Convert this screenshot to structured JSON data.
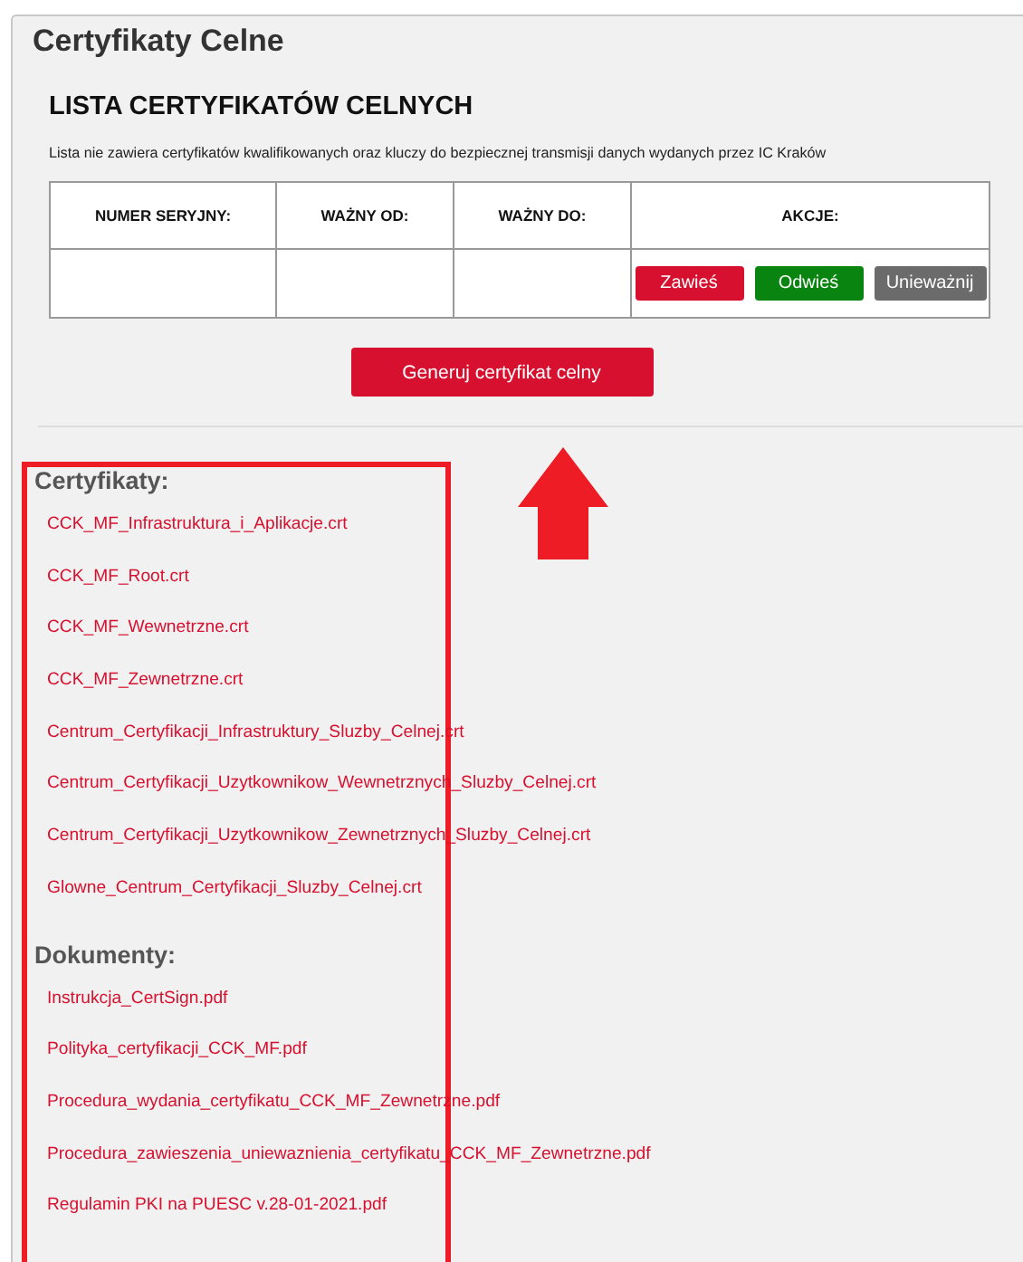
{
  "page": {
    "title": "Certyfikaty Celne"
  },
  "list": {
    "heading": "LISTA CERTYFIKATÓW CELNYCH",
    "note": "Lista nie zawiera certyfikatów kwalifikowanych oraz kluczy do bezpiecznej transmisji danych wydanych przez IC Kraków"
  },
  "table": {
    "columns": [
      "NUMER SERYJNY:",
      "WAŻNY OD:",
      "WAŻNY DO:",
      "AKCJE:"
    ],
    "actions": [
      {
        "label": "Zawieś",
        "kind": "suspend"
      },
      {
        "label": "Odwieś",
        "kind": "resume"
      },
      {
        "label": "Unieważnij",
        "kind": "revoke"
      }
    ]
  },
  "generate_button": "Generuj certyfikat celny",
  "sections": [
    {
      "title": "Certyfikaty:",
      "links": [
        "CCK_MF_Infrastruktura_i_Aplikacje.crt",
        "CCK_MF_Root.crt",
        "CCK_MF_Wewnetrzne.crt",
        "CCK_MF_Zewnetrzne.crt",
        "Centrum_Certyfikacji_Infrastruktury_Sluzby_Celnej.crt",
        "Centrum_Certyfikacji_Uzytkownikow_Wewnetrznych_Sluzby_Celnej.crt",
        "Centrum_Certyfikacji_Uzytkownikow_Zewnetrznych_Sluzby_Celnej.crt",
        "Glowne_Centrum_Certyfikacji_Sluzby_Celnej.crt"
      ]
    },
    {
      "title": "Dokumenty:",
      "links": [
        "Instrukcja_CertSign.pdf",
        "Polityka_certyfikacji_CCK_MF.pdf",
        "Procedura_wydania_certyfikatu_CCK_MF_Zewnetrzne.pdf",
        "Procedura_zawieszenia_uniewaznienia_certyfikatu_CCK_MF_Zewnetrzne.pdf",
        "Regulamin PKI na PUESC v.28-01-2021.pdf"
      ]
    }
  ]
}
